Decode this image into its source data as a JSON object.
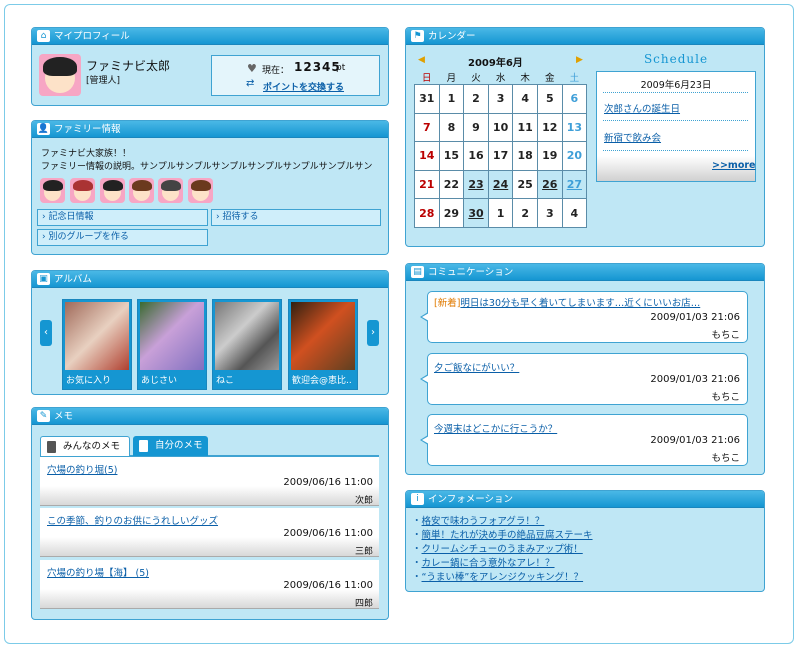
{
  "profile": {
    "header": "マイプロフィール",
    "name": "ファミナビ太郎",
    "role": "[管理人]",
    "points_label": "現在：",
    "points_value": "12345",
    "points_unit": "pt",
    "exchange_link": "ポイントを交換する"
  },
  "family": {
    "header": "ファミリー情報",
    "family_name": "ファミナビ大家族！！",
    "description": "ファミリー情報の説明。サンプルサンプルサンプルサンプルサンプルサンプルサン",
    "anniversary_button": "記念日情報",
    "invite_button": "招待する",
    "create_group_button": "別のグループを作る"
  },
  "album": {
    "header": "アルバム",
    "photos": [
      {
        "caption": "お気に入り"
      },
      {
        "caption": "あじさい"
      },
      {
        "caption": "ねこ"
      },
      {
        "caption": "歓迎会@恵比.."
      }
    ]
  },
  "memo": {
    "header": "メモ",
    "tabs": [
      {
        "label": "みんなのメモ"
      },
      {
        "label": "自分のメモ"
      }
    ],
    "items": [
      {
        "title": "穴場の釣り堀(5)",
        "date": "2009/06/16 11:00",
        "user": "次郎"
      },
      {
        "title": "この季節、釣りのお供にうれしいグッズ",
        "date": "2009/06/16 11:00",
        "user": "三郎"
      },
      {
        "title": "穴場の釣り場【海】 (5)",
        "date": "2009/06/16 11:00",
        "user": "四郎"
      }
    ]
  },
  "calendar": {
    "header": "カレンダー",
    "month": "2009年6月",
    "weekdays": [
      "日",
      "月",
      "火",
      "水",
      "木",
      "金",
      "土"
    ],
    "weeks": [
      [
        "31",
        "1",
        "2",
        "3",
        "4",
        "5",
        "6"
      ],
      [
        "7",
        "8",
        "9",
        "10",
        "11",
        "12",
        "13"
      ],
      [
        "14",
        "15",
        "16",
        "17",
        "18",
        "19",
        "20"
      ],
      [
        "21",
        "22",
        "23",
        "24",
        "25",
        "26",
        "27"
      ],
      [
        "28",
        "29",
        "30",
        "1",
        "2",
        "3",
        "4"
      ]
    ],
    "schedule_title": "Schedule",
    "schedule_date": "2009年6月23日",
    "events": [
      "次郎さんの誕生日",
      "新宿で飲み会"
    ],
    "more": ">>more"
  },
  "communication": {
    "header": "コミュニケーション",
    "posts": [
      {
        "tag": "[新着]",
        "title": "明日は30分も早く着いてしまいます…近くにいいお店…",
        "date": "2009/01/03 21:06",
        "user": "もちこ"
      },
      {
        "title": "夕ご飯なにがいい？",
        "date": "2009/01/03 21:06",
        "user": "もちこ"
      },
      {
        "title": "今週末はどこかに行こうか？",
        "date": "2009/01/03 21:06",
        "user": "もちこ"
      }
    ]
  },
  "information": {
    "header": "インフォメーション",
    "items": [
      "格安で味わうフォアグラ！？",
      "簡単！たれが決め手の絶品豆腐ステーキ",
      "クリームシチューのうまみアップ術！",
      "カレー鍋に合う意外なアレ！？",
      "“うまい棒”をアレンジクッキング！？"
    ]
  },
  "colors": {
    "accent": "#1596d2",
    "panel_bg": "#bfe7f5",
    "today": "#f5bf1a",
    "sunday": "#b00000",
    "saturday": "#3f9fd8"
  }
}
